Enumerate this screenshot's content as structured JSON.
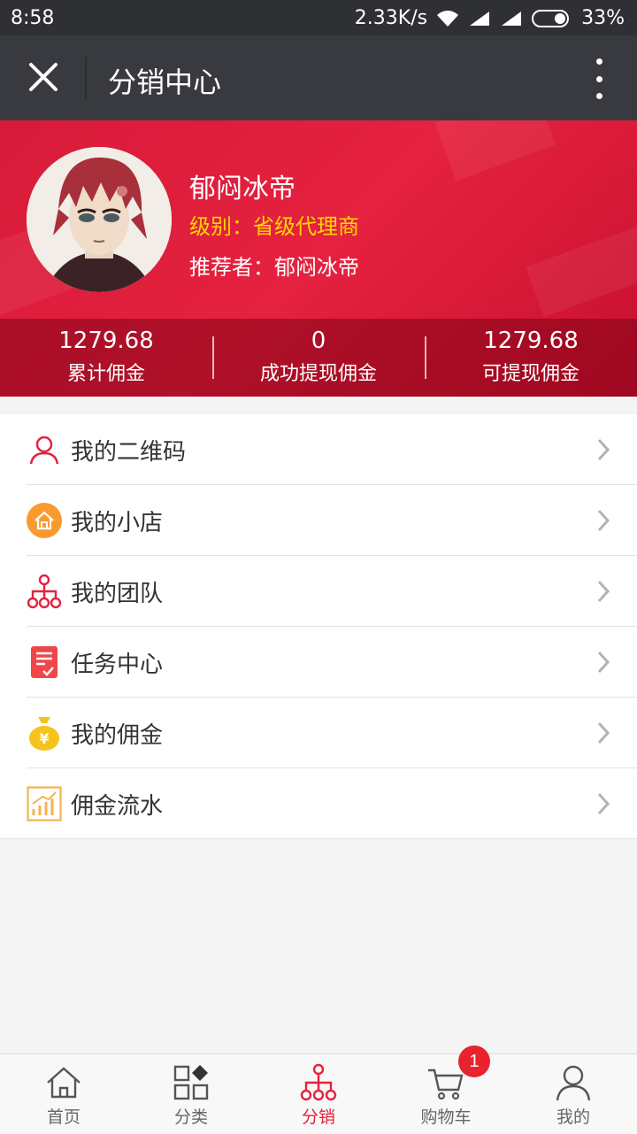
{
  "status_bar": {
    "time": "8:58",
    "speed": "2.33K/s",
    "battery": "33%"
  },
  "app_bar": {
    "title": "分销中心",
    "close_icon": "close-icon",
    "more_icon": "more-vertical-icon"
  },
  "profile": {
    "name": "郁闷冰帝",
    "level_label": "级别：",
    "level_value": "省级代理商",
    "referrer": "推荐者：郁闷冰帝"
  },
  "stats": [
    {
      "value": "1279.68",
      "label": "累计佣金"
    },
    {
      "value": "0",
      "label": "成功提现佣金"
    },
    {
      "value": "1279.68",
      "label": "可提现佣金"
    }
  ],
  "menu": [
    {
      "label": "我的二维码",
      "icon": "user-outline-icon"
    },
    {
      "label": "我的小店",
      "icon": "home-circle-icon"
    },
    {
      "label": "我的团队",
      "icon": "team-tree-icon"
    },
    {
      "label": "任务中心",
      "icon": "task-list-icon"
    },
    {
      "label": "我的佣金",
      "icon": "money-bag-icon"
    },
    {
      "label": "佣金流水",
      "icon": "chart-icon"
    }
  ],
  "tabs": [
    {
      "label": "首页",
      "icon": "home-icon"
    },
    {
      "label": "分类",
      "icon": "category-icon"
    },
    {
      "label": "分销",
      "icon": "distribution-icon",
      "active": true
    },
    {
      "label": "购物车",
      "icon": "cart-icon",
      "badge": "1"
    },
    {
      "label": "我的",
      "icon": "user-icon"
    }
  ],
  "colors": {
    "brand_red": "#e5223f",
    "level_gold": "#ffd700",
    "appbar": "#393a3f"
  }
}
